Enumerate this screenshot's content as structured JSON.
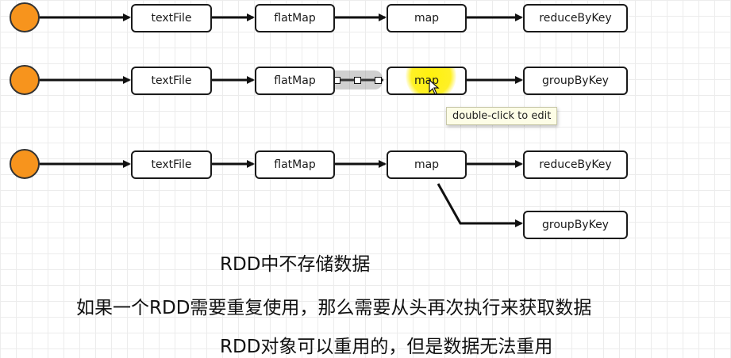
{
  "rows": [
    {
      "nodes": [
        "textFile",
        "flatMap",
        "map",
        "reduceByKey"
      ]
    },
    {
      "nodes": [
        "textFile",
        "flatMap",
        "map",
        "groupByKey"
      ]
    },
    {
      "nodes": [
        "textFile",
        "flatMap",
        "map",
        "reduceByKey",
        "groupByKey"
      ]
    }
  ],
  "tooltip": "double-click to edit",
  "notes": [
    "RDD中不存储数据",
    "如果一个RDD需要重复使用，那么需要从头再次执行来获取数据",
    "RDD对象可以重用的，但是数据无法重用"
  ],
  "colors": {
    "start": "#f7941d",
    "edge": "#111111",
    "highlight": "#ffee00"
  }
}
